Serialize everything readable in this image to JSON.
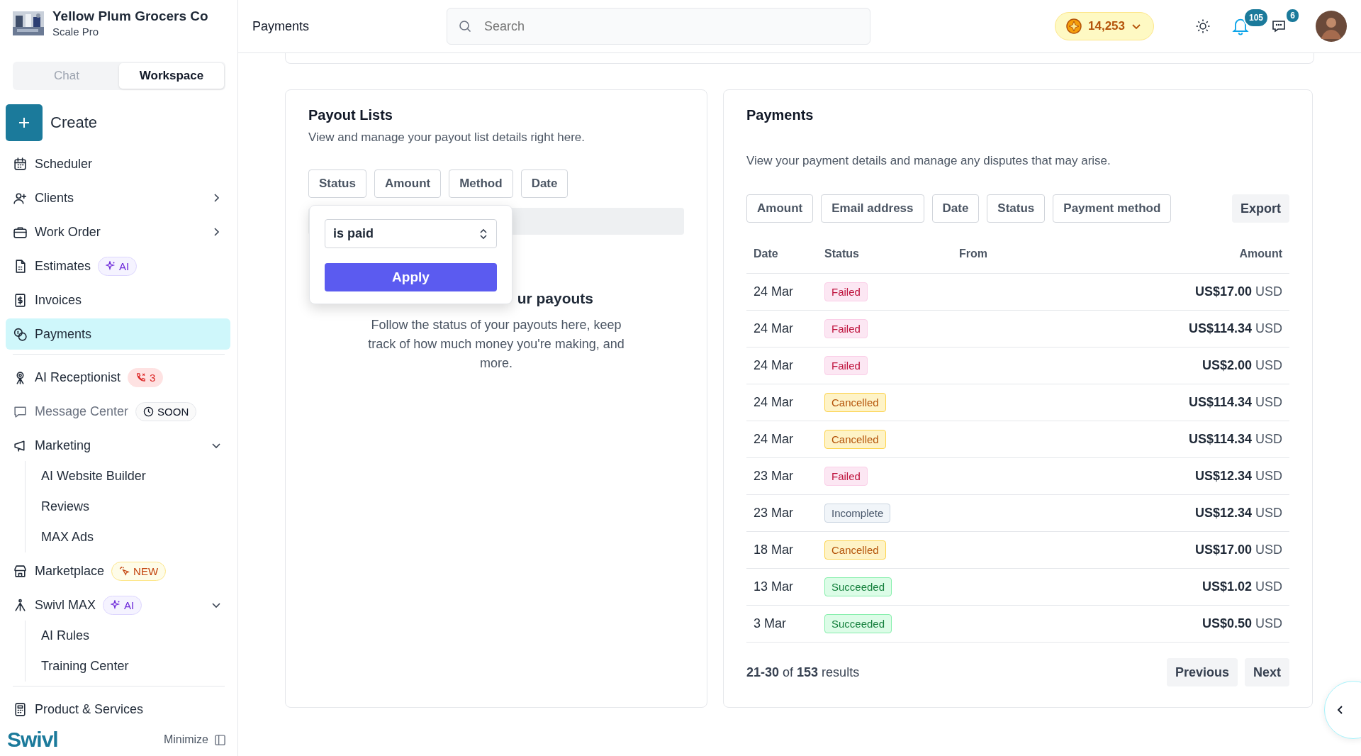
{
  "org": {
    "name": "Yellow Plum Grocers Co",
    "plan": "Scale Pro"
  },
  "mode_tabs": [
    {
      "label": "Chat",
      "selected": false
    },
    {
      "label": "Workspace",
      "selected": true
    }
  ],
  "create": {
    "label": "Create"
  },
  "sidebar": {
    "items": [
      {
        "label": "Scheduler",
        "selected": false,
        "disabled": false
      },
      {
        "label": "Clients",
        "selected": false,
        "disabled": false,
        "expanded": false
      },
      {
        "label": "Work Order",
        "selected": false,
        "disabled": false,
        "expanded": false
      },
      {
        "label": "Estimates",
        "selected": false,
        "disabled": false,
        "badge": {
          "kind": "ai",
          "text": "AI"
        }
      },
      {
        "label": "Invoices",
        "selected": false,
        "disabled": false
      },
      {
        "label": "Payments",
        "selected": true,
        "disabled": false,
        "divider_after": true
      },
      {
        "label": "AI Receptionist",
        "selected": false,
        "disabled": false,
        "badge": {
          "kind": "alert",
          "text": "3"
        }
      },
      {
        "label": "Message Center",
        "selected": false,
        "disabled": true,
        "badge": {
          "kind": "soon",
          "text": "SOON"
        }
      },
      {
        "label": "Marketing",
        "selected": false,
        "disabled": false,
        "expanded": true,
        "children": [
          {
            "label": "AI Website Builder"
          },
          {
            "label": "Reviews"
          },
          {
            "label": "MAX Ads"
          }
        ]
      },
      {
        "label": "Marketplace",
        "selected": false,
        "disabled": false,
        "badge": {
          "kind": "new",
          "text": "NEW"
        }
      },
      {
        "label": "Swivl MAX",
        "selected": false,
        "disabled": false,
        "expanded": true,
        "badge": {
          "kind": "ai",
          "text": "AI"
        },
        "children": [
          {
            "label": "AI Rules"
          },
          {
            "label": "Training Center"
          }
        ],
        "divider_after": true
      },
      {
        "label": "Product & Services",
        "selected": false,
        "disabled": false
      }
    ]
  },
  "footer": {
    "logo": "Swivl",
    "minimize": "Minimize"
  },
  "topbar": {
    "title": "Payments",
    "search": {
      "placeholder": "Search"
    },
    "coins": "14,253",
    "notifications": "105",
    "messages": "6"
  },
  "payouts": {
    "title": "Payout Lists",
    "subtitle": "View and manage your payout list details right here.",
    "filters": [
      "Status",
      "Amount",
      "Method",
      "Date"
    ],
    "popover": {
      "select_value": "is paid",
      "apply": "Apply"
    },
    "empty_heading": "ur payouts",
    "empty_text": "Follow the status of your payouts here, keep track of how much money you're making, and more."
  },
  "payments": {
    "title": "Payments",
    "subtitle": "View your payment details and manage any disputes that may arise.",
    "filters": [
      "Amount",
      "Email address",
      "Date",
      "Status",
      "Payment method"
    ],
    "export": "Export",
    "columns": [
      "Date",
      "Status",
      "From",
      "Amount"
    ],
    "rows": [
      {
        "date": "24 Mar",
        "status": "Failed",
        "kind": "failed",
        "amount": "US$17.00",
        "currency": "USD"
      },
      {
        "date": "24 Mar",
        "status": "Failed",
        "kind": "failed",
        "amount": "US$114.34",
        "currency": "USD"
      },
      {
        "date": "24 Mar",
        "status": "Failed",
        "kind": "failed",
        "amount": "US$2.00",
        "currency": "USD"
      },
      {
        "date": "24 Mar",
        "status": "Cancelled",
        "kind": "cancelled",
        "amount": "US$114.34",
        "currency": "USD"
      },
      {
        "date": "24 Mar",
        "status": "Cancelled",
        "kind": "cancelled",
        "amount": "US$114.34",
        "currency": "USD"
      },
      {
        "date": "23 Mar",
        "status": "Failed",
        "kind": "failed",
        "amount": "US$12.34",
        "currency": "USD"
      },
      {
        "date": "23 Mar",
        "status": "Incomplete",
        "kind": "incomplete",
        "amount": "US$12.34",
        "currency": "USD"
      },
      {
        "date": "18 Mar",
        "status": "Cancelled",
        "kind": "cancelled",
        "amount": "US$17.00",
        "currency": "USD"
      },
      {
        "date": "13 Mar",
        "status": "Succeeded",
        "kind": "succeeded",
        "amount": "US$1.02",
        "currency": "USD"
      },
      {
        "date": "3 Mar",
        "status": "Succeeded",
        "kind": "succeeded",
        "amount": "US$0.50",
        "currency": "USD"
      }
    ],
    "summary": "**21-30** of **153** results",
    "previous": "Previous",
    "next": "Next"
  }
}
